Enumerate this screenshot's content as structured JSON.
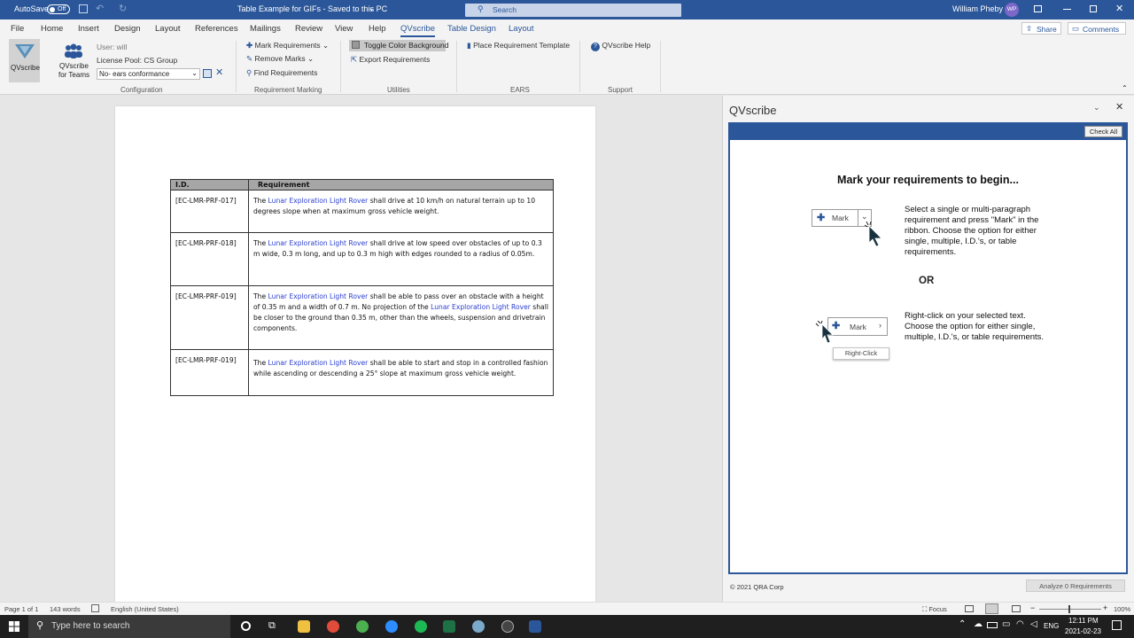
{
  "titlebar": {
    "autosave": "AutoSave",
    "autosave_state": "Off",
    "doc_title": "Table Example for GIFs  -  Saved to this PC",
    "search_placeholder": "Search",
    "user_name": "William Pheby",
    "user_initials": "WP"
  },
  "tabs": [
    "File",
    "Home",
    "Insert",
    "Design",
    "Layout",
    "References",
    "Mailings",
    "Review",
    "View",
    "Help",
    "QVscribe",
    "Table Design",
    "Layout"
  ],
  "share_label": "Share",
  "comments_label": "Comments",
  "ribbon": {
    "qvscribe_btn": "QVscribe",
    "teams_btn_line1": "QVscribe",
    "teams_btn_line2": "for Teams",
    "user": "User: will",
    "license_pool": "License Pool: CS Group",
    "ears_select": "No- ears conformance",
    "config_label": "Configuration",
    "mark_requirements": "Mark Requirements",
    "remove_marks": "Remove Marks",
    "find_requirements": "Find Requirements",
    "req_marking_label": "Requirement Marking",
    "toggle_color": "Toggle Color Background",
    "export_requirements": "Export Requirements",
    "utilities_label": "Utilities",
    "place_template": "Place Requirement Template",
    "ears_label": "EARS",
    "help": "QVscribe Help",
    "support_label": "Support"
  },
  "table": {
    "headers": [
      "I.D.",
      "Requirement"
    ],
    "rows": [
      {
        "id": "[EC-LMR-PRF-017]",
        "pre": "The ",
        "term": "Lunar Exploration Light Rover",
        "post": " shall drive at 10 km/h on natural terrain up to 10 degrees slope when at maximum gross vehicle weight."
      },
      {
        "id": "[EC-LMR-PRF-018]",
        "pre": "The ",
        "term": "Lunar Exploration Light Rover",
        "post": " shall drive at low speed over obstacles of up to 0.3 m wide, 0.3 m long, and up to 0.3 m high with edges rounded to a radius of 0.05m."
      },
      {
        "id": "[EC-LMR-PRF-019]",
        "pre": "The ",
        "term": "Lunar Exploration Light Rover",
        "mid": " shall be able to pass over an obstacle with a height of 0.35 m and a width of 0.7 m.  No projection of the ",
        "term2": "Lunar Exploration Light Rover",
        "post": " shall be closer to the ground than 0.35 m, other than the wheels, suspension and drivetrain components."
      },
      {
        "id": "[EC-LMR-PRF-019]",
        "pre": "The ",
        "term": "Lunar Exploration Light Rover",
        "post": " shall be able to start and stop in a controlled fashion while ascending or descending a 25° slope at maximum gross vehicle weight."
      }
    ]
  },
  "pane": {
    "title": "QVscribe",
    "check_all": "Check All",
    "heading": "Mark your requirements to begin...",
    "instr1": "Select a single or multi-paragraph requirement and press \"Mark\" in the ribbon. Choose the option for either single, multiple, I.D.'s, or table requirements.",
    "mark_label": "Mark",
    "or": "OR",
    "instr2": "Right-click on your selected text. Choose the option for either single, multiple, I.D.'s, or table requirements.",
    "right_click": "Right-Click",
    "copyright": "© 2021 QRA Corp",
    "analyze": "Analyze 0 Requirements"
  },
  "status": {
    "page": "Page 1 of 1",
    "words": "143 words",
    "language": "English (United States)",
    "focus": "Focus",
    "zoom": "100%"
  },
  "taskbar": {
    "search_placeholder": "Type here to search",
    "lang": "ENG",
    "time": "12:11 PM",
    "date": "2021-02-23"
  }
}
